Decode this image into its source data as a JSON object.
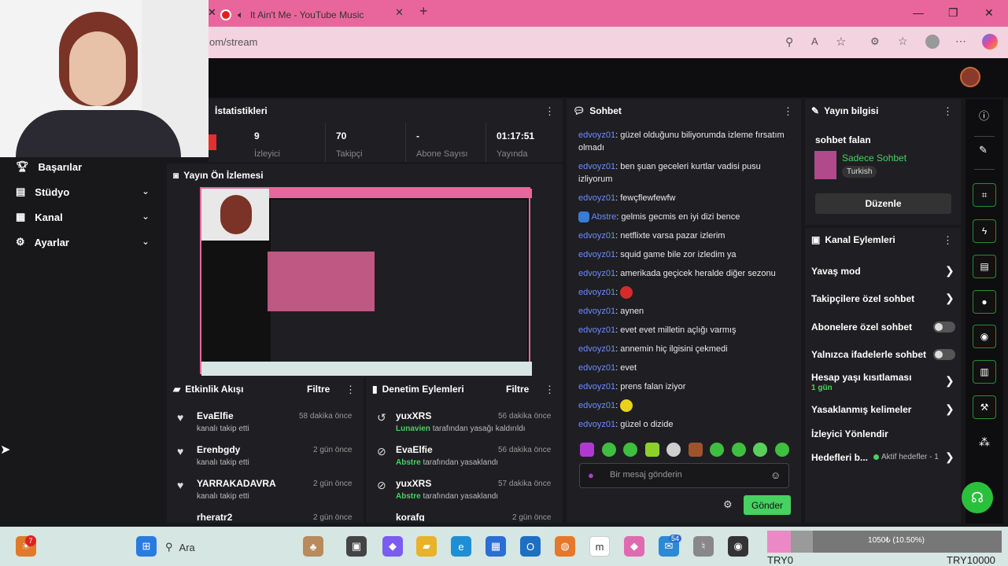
{
  "browser": {
    "tab_title": "It Ain't Me - YouTube Music",
    "new_tab": "+",
    "url": "om/stream",
    "window_controls": [
      "—",
      "❐",
      "✕"
    ]
  },
  "sidebar": {
    "items": [
      {
        "label": "Başarılar",
        "icon": "trophy-icon",
        "chevron": false
      },
      {
        "label": "Stüdyo",
        "icon": "studio-icon",
        "chevron": true
      },
      {
        "label": "Kanal",
        "icon": "channel-icon",
        "chevron": true
      },
      {
        "label": "Ayarlar",
        "icon": "gear-icon",
        "chevron": true
      }
    ]
  },
  "stats": {
    "title": "İstatistikleri",
    "items": [
      {
        "value": "9",
        "label": "İzleyici"
      },
      {
        "value": "70",
        "label": "Takipçi"
      },
      {
        "value": "-",
        "label": "Abone Sayısı"
      },
      {
        "value": "01:17:51",
        "label": "Yayında"
      }
    ]
  },
  "preview": {
    "title": "Yayın Ön İzlemesi"
  },
  "activity": {
    "title": "Etkinlik Akışı",
    "filter": "Filtre",
    "items": [
      {
        "name": "EvaElfie",
        "sub": "kanalı takip etti",
        "time": "58 dakika önce"
      },
      {
        "name": "Erenbgdy",
        "sub": "kanalı takip etti",
        "time": "2 gün önce"
      },
      {
        "name": "YARRAKADAVRA",
        "sub": "kanalı takip etti",
        "time": "2 gün önce"
      },
      {
        "name": "rheratr2",
        "sub": "",
        "time": "2 gün önce"
      }
    ]
  },
  "moderation": {
    "title": "Denetim Eylemleri",
    "filter": "Filtre",
    "items": [
      {
        "name": "yuxXRS",
        "actor": "Lunavien",
        "sub": "tarafından yasağı kaldırıldı",
        "time": "56 dakika önce"
      },
      {
        "name": "EvaElfie",
        "actor": "Abstre",
        "sub": "tarafından yasaklandı",
        "time": "56 dakika önce"
      },
      {
        "name": "yuxXRS",
        "actor": "Abstre",
        "sub": "tarafından yasaklandı",
        "time": "57 dakika önce"
      },
      {
        "name": "korafg",
        "actor": "",
        "sub": "",
        "time": "2 gün önce"
      }
    ]
  },
  "chat": {
    "title": "Sohbet",
    "messages": [
      {
        "user": "edvoyz01",
        "text": ": güzel olduğunu biliyorumda izleme fırsatım olmadı"
      },
      {
        "user": "edvoyz01",
        "text": ": ben şuan geceleri kurtlar vadisi pusu izliyorum"
      },
      {
        "user": "edvoyz01",
        "text": ": fewçflewfewfw"
      },
      {
        "user": "Abstre",
        "text": ": gelmis gecmis en iyi dizi bence"
      },
      {
        "user": "edvoyz01",
        "text": ": netflixte varsa pazar izlerim"
      },
      {
        "user": "edvoyz01",
        "text": ": squid game bile zor izledim ya"
      },
      {
        "user": "edvoyz01",
        "text": ": amerikada geçicek heralde diğer sezonu"
      },
      {
        "user": "edvoyz01",
        "text": ":"
      },
      {
        "user": "edvoyz01",
        "text": ": aynen"
      },
      {
        "user": "edvoyz01",
        "text": ": evet evet milletin açlığı varmış"
      },
      {
        "user": "edvoyz01",
        "text": ": annemin hiç ilgisini çekmedi"
      },
      {
        "user": "edvoyz01",
        "text": ": evet"
      },
      {
        "user": "edvoyz01",
        "text": ": prens falan iziyor"
      },
      {
        "user": "edvoyz01",
        "text": ":"
      },
      {
        "user": "edvoyz01",
        "text": ": güzel o dizide"
      }
    ],
    "placeholder": "Bir mesaj gönderin",
    "send": "Gönder"
  },
  "stream_info": {
    "title": "Yayın bilgisi",
    "stream_title": "sohbet falan",
    "category": "Sadece Sohbet",
    "tag": "Turkish",
    "edit": "Düzenle"
  },
  "channel_actions": {
    "title": "Kanal Eylemleri",
    "items": [
      {
        "label": "Yavaş mod",
        "control": "arrow"
      },
      {
        "label": "Takipçilere özel sohbet",
        "control": "arrow"
      },
      {
        "label": "Abonelere özel sohbet",
        "control": "toggle"
      },
      {
        "label": "Yalnızca ifadelerle sohbet",
        "control": "toggle"
      },
      {
        "label": "Hesap yaşı kısıtlaması",
        "sub": "1 gün",
        "control": "arrow"
      },
      {
        "label": "Yasaklanmış kelimeler",
        "control": "arrow"
      },
      {
        "label": "İzleyici Yönlendir",
        "control": "none"
      },
      {
        "label": "Hedefleri b...",
        "sub": "Aktif hedefler - 1",
        "control": "arrow"
      }
    ]
  },
  "taskbar": {
    "search": "Ara",
    "badge_left": "7",
    "badge_mail": "54",
    "tray_progress_label": "1050₺ (10.50%)",
    "tray_progress_fraction": 0.105,
    "tray_min": "TRY0",
    "tray_max": "TRY10000"
  },
  "colors": {
    "accent": "#46d160",
    "tabbar": "#e9669c",
    "panel": "#1f1f23"
  }
}
